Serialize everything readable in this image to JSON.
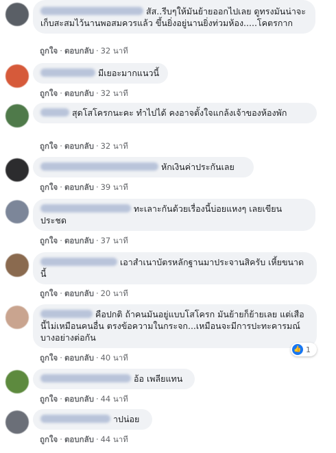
{
  "actions": {
    "like": "ถูกใจ",
    "reply": "ตอบกลับ",
    "separator": "·"
  },
  "comments": [
    {
      "text": "สัส..รีบๆให้มันย้ายออกไปเลย ดูทรงมันน่าจะเก็บสะสมไว้นานพอสมควรแล้ว ขึ้นยิ่งอยู่นานยิ่งท่วมห้อง.....โคตรกาก",
      "time": "32 นาที",
      "avatar_color": "#5a5f66"
    },
    {
      "text": "มีเยอะมากแนวนี้",
      "time": "32 นาที",
      "avatar_color": "#d65a3a"
    },
    {
      "text": "สุดโสโครกนะคะ ทำไปได้ คงอาจตั้งใจแกล้งเจ้าของห้องพัก",
      "time": "32 นาที",
      "avatar_color": "#4f7a4a"
    },
    {
      "text": "หักเงินค่าประกันเลย",
      "time": "39 นาที",
      "avatar_color": "#2c2c2e"
    },
    {
      "text": "ทะเลาะกันด้วยเรื่องนี้บ่อยแหงๆ เลยเขียนประชด",
      "time": "37 นาที",
      "avatar_color": "#7c8699"
    },
    {
      "text": "เอาสำเนาบัตรหลักฐานมาประจานสิครับ เหี้ยขนาดนี้",
      "time": "20 นาที",
      "avatar_color": "#8a6a4f"
    },
    {
      "text": "คือปกติ ถ้าคนมันอยู่แบบโสโครก มันย้ายก็ย้ายเลย แต่เสือนี้ไม่เหมือนคนอื่น ตรงข้อความในกระจก...เหมือนจะมีการปะทะคารมณ์บางอย่างต่อกัน",
      "time": "40 นาที",
      "avatar_color": "#c9a48f",
      "reaction_count": "1"
    },
    {
      "text": "อ้อ เพลียแทน",
      "time": "44 นาที",
      "avatar_color": "#5d8a3e"
    },
    {
      "text": "าปน่อย",
      "time": "44 นาที",
      "avatar_color": "#6b6f78"
    }
  ]
}
